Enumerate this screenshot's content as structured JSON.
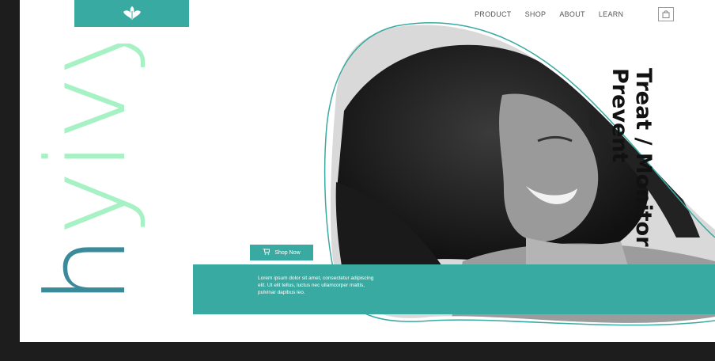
{
  "brand": {
    "wordmark": "hyivy"
  },
  "nav": {
    "items": [
      "PRODUCT",
      "SHOP",
      "ABOUT",
      "LEARN"
    ]
  },
  "hero": {
    "tagline_line1": "Treat / Monitor",
    "tagline_line2": "Prevent",
    "shop_button": "Shop Now",
    "description": "Lorem ipsum dolor sit amet, consectetur adipiscing elit. Ut elit tellus, luctus nec ullamcorper mattis, pulvinar dapibus leo."
  },
  "icons": {
    "logo": "leaf-logo-icon",
    "cart": "shopping-bag-icon",
    "shop": "cart-icon"
  },
  "colors": {
    "accent": "#39aaa1",
    "wordmark_mint": "#a6f2c4",
    "wordmark_teal": "#3a8a9a",
    "frame": "#1d1d1d"
  }
}
